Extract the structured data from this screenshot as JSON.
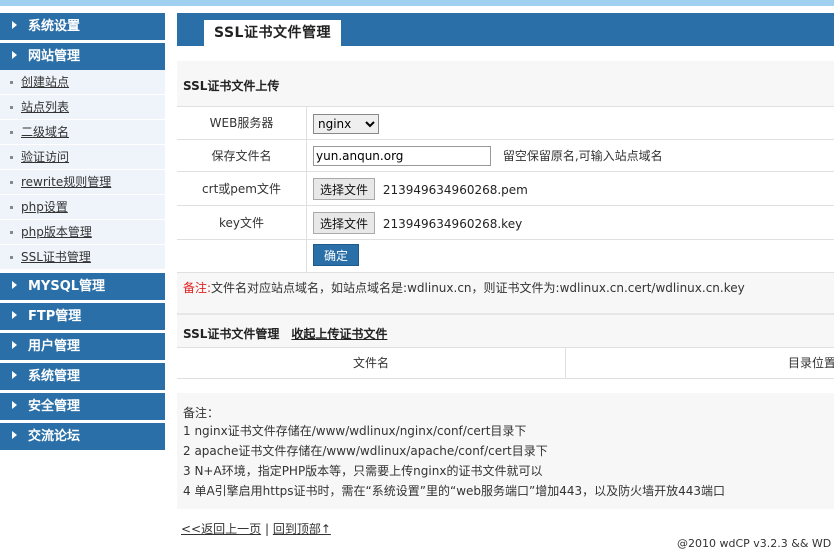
{
  "sidebar": {
    "groups": [
      {
        "label": "系统设置"
      },
      {
        "label": "网站管理",
        "items": [
          {
            "label": "创建站点"
          },
          {
            "label": "站点列表"
          },
          {
            "label": "二级域名"
          },
          {
            "label": "验证访问"
          },
          {
            "label": "rewrite规则管理"
          },
          {
            "label": "php设置"
          },
          {
            "label": "php版本管理"
          },
          {
            "label": "SSL证书管理"
          }
        ]
      },
      {
        "label": "MYSQL管理"
      },
      {
        "label": "FTP管理"
      },
      {
        "label": "用户管理"
      },
      {
        "label": "系统管理"
      },
      {
        "label": "安全管理"
      },
      {
        "label": "交流论坛"
      }
    ]
  },
  "page": {
    "title": "SSL证书文件管理"
  },
  "upload": {
    "section_title": "SSL证书文件上传",
    "web_server_label": "WEB服务器",
    "web_server_value": "nginx",
    "save_name_label": "保存文件名",
    "save_name_value": "yun.anqun.org",
    "save_name_hint": "留空保留原名,可输入站点域名",
    "crt_label": "crt或pem文件",
    "crt_button": "选择文件",
    "crt_file": "213949634960268.pem",
    "key_label": "key文件",
    "key_button": "选择文件",
    "key_file": "213949634960268.key",
    "submit_label": "确定",
    "note_prefix": "备注:",
    "note_text": "文件名对应站点域名，如站点域名是:wdlinux.cn，则证书文件为:wdlinux.cn.cert/wdlinux.cn.key"
  },
  "list": {
    "title": "SSL证书文件管理",
    "collapse_link": "收起上传证书文件",
    "col_filename": "文件名",
    "col_dir": "目录位置"
  },
  "remarks": {
    "title": "备注：",
    "lines": [
      "1 nginx证书文件存储在/www/wdlinux/nginx/conf/cert目录下",
      "2 apache证书文件存储在/www/wdlinux/apache/conf/cert目录下",
      "3 N+A环境，指定PHP版本等，只需要上传nginx的证书文件就可以",
      "4 单A引擎启用https证书时，需在“系统设置”里的“web服务端口”增加443，以及防火墙开放443端口"
    ]
  },
  "footer": {
    "back_link": "<<返回上一页",
    "separator": "|",
    "top_link": "回到顶部↑",
    "copyright": "@2010 wdCP v3.2.3 && WD"
  },
  "colors": {
    "accent": "#2a6fa8",
    "top_strip": "#9fd0f0",
    "note_red": "#e02020"
  }
}
